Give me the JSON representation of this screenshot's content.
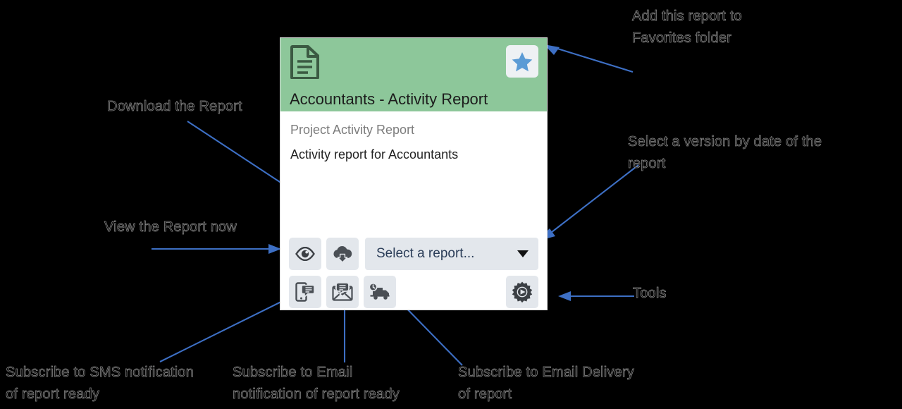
{
  "card": {
    "title": "Accountants - Activity Report",
    "doc_icon": "document-icon",
    "favorite_icon": "star-icon",
    "subtitle": "Project Activity Report",
    "description": "Activity report for Accountants",
    "header_color": "#8dc79a",
    "star_color": "#5b9bd5",
    "toolbar": {
      "view_icon": "eye-icon",
      "download_icon": "cloud-download-icon",
      "sms_icon": "phone-chat-icon",
      "email_icon": "envelope-chat-icon",
      "delivery_icon": "truck-clock-icon",
      "tools_icon": "gear-play-icon",
      "select_value": "Select a report...",
      "select_caret": "chevron-down-icon"
    }
  },
  "annotations": {
    "favorites": "Add this report to\nFavorites folder",
    "download": "Download the Report",
    "version": "Select a version by date of the\nreport",
    "view": "View the Report now",
    "tools": "Tools",
    "sms": "Subscribe to SMS notification\nof report ready",
    "email_notify": "Subscribe to Email\nnotification of report ready",
    "email_delivery": "Subscribe to Email Delivery\nof report"
  },
  "colors": {
    "background": "#000000",
    "arrow": "#3d6fc4",
    "annotation_text": "#050505",
    "button_bg": "#e3e7ec"
  }
}
